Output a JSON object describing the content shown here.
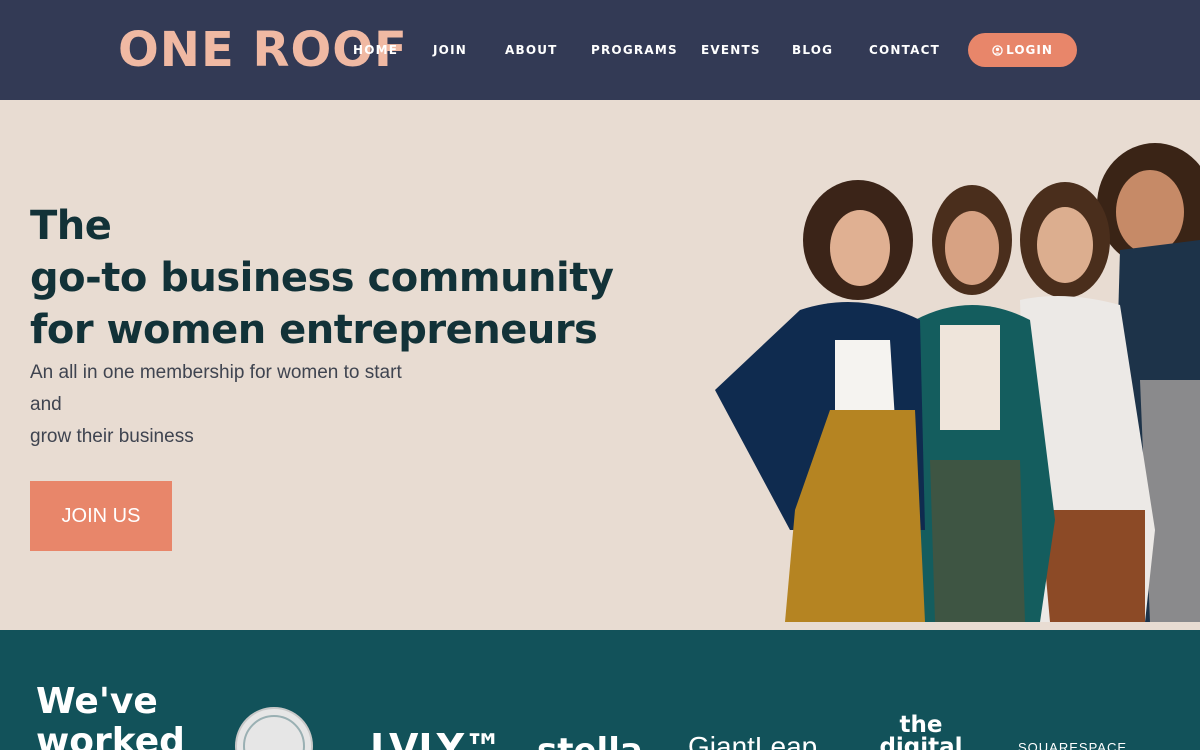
{
  "header": {
    "logo": "ONE ROOF",
    "nav": [
      "HOME",
      "JOIN",
      "ABOUT",
      "PROGRAMS",
      "EVENTS",
      "BLOG",
      "CONTACT"
    ],
    "login_label": "LOGIN"
  },
  "hero": {
    "headline_1": "The",
    "headline_2": "go-to business community",
    "headline_3": "for women entrepreneurs",
    "sub_1": "An all in one membership for women to start",
    "sub_2": "and",
    "sub_3": "grow their business",
    "cta": "JOIN US"
  },
  "partners": {
    "heading_1": "We've",
    "heading_2": "worked",
    "logos": [
      "LVLY™",
      "stella",
      "GiantLeap",
      "the digital",
      "SQUARESPACE"
    ]
  },
  "colors": {
    "header_bg": "#333a55",
    "hero_bg": "#e8dcd2",
    "accent": "#e8866a",
    "logo": "#f0b9a3",
    "headline": "#123238",
    "partners_bg": "#12525a"
  }
}
